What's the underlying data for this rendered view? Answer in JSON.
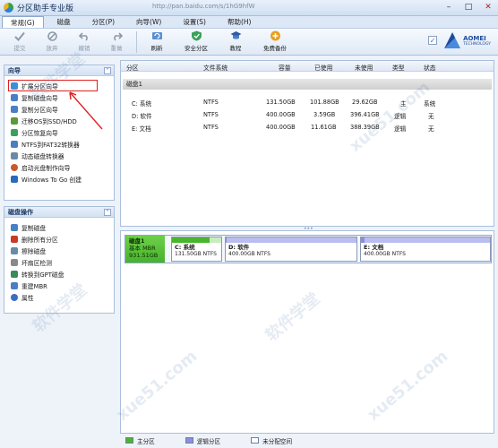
{
  "window": {
    "title": "分区助手专业版",
    "url_overlay": "http://pan.baidu.com/s/1hG9hfW"
  },
  "menu": [
    {
      "label": "常规(G)"
    },
    {
      "label": "磁盘"
    },
    {
      "label": "分区(P)"
    },
    {
      "label": "向导(W)"
    },
    {
      "label": "设置(S)"
    },
    {
      "label": "帮助(H)"
    }
  ],
  "toolbar": {
    "items": [
      {
        "label": "提交",
        "icon": "check-icon",
        "enabled": false
      },
      {
        "label": "放弃",
        "icon": "discard-icon",
        "enabled": false
      },
      {
        "label": "撤销",
        "icon": "undo-icon",
        "enabled": false
      },
      {
        "label": "重做",
        "icon": "redo-icon",
        "enabled": false
      },
      {
        "label": "刷新",
        "icon": "refresh-icon",
        "enabled": true
      },
      {
        "label": "安全分区",
        "icon": "safe-partition-icon",
        "enabled": true
      },
      {
        "label": "教程",
        "icon": "tutorial-icon",
        "enabled": true
      },
      {
        "label": "免费备份",
        "icon": "backup-icon",
        "enabled": true
      }
    ],
    "brand": {
      "name": "AOMEI",
      "sub": "TECHNOLOGY"
    }
  },
  "wizard_panel": {
    "title": "向导",
    "items": [
      {
        "label": "扩展分区向导",
        "color": "#3a8fd8"
      },
      {
        "label": "复制磁盘向导",
        "color": "#4a7fc4"
      },
      {
        "label": "复制分区向导",
        "color": "#4a7fc4"
      },
      {
        "label": "迁移OS到SSD/HDD",
        "color": "#5a9a3a"
      },
      {
        "label": "分区恢复向导",
        "color": "#3aa15a"
      },
      {
        "label": "NTFS到FAT32转换器",
        "color": "#4a7fc4"
      },
      {
        "label": "动态磁盘转换器",
        "color": "#6a8aa8"
      },
      {
        "label": "启动光盘制作向导",
        "color": "#c85a2a"
      },
      {
        "label": "Windows To Go 创建",
        "color": "#2a6ab8"
      }
    ]
  },
  "disk_ops_panel": {
    "title": "磁盘操作",
    "items": [
      {
        "label": "复制磁盘",
        "color": "#4a7fc4"
      },
      {
        "label": "删除所有分区",
        "color": "#c83a2a"
      },
      {
        "label": "擦除磁盘",
        "color": "#6a8aa8"
      },
      {
        "label": "坏扇区检测",
        "color": "#8a8a8a"
      },
      {
        "label": "转换到GPT磁盘",
        "color": "#3a8a5a"
      },
      {
        "label": "重建MBR",
        "color": "#4a7fc4"
      },
      {
        "label": "属性",
        "color": "#3a6fbf"
      }
    ]
  },
  "partition_table": {
    "columns": [
      "分区",
      "文件系统",
      "容量",
      "已使用",
      "未使用",
      "类型",
      "状态"
    ],
    "disk_label": "磁盘1",
    "rows": [
      {
        "partition": "C: 系统",
        "fs": "NTFS",
        "capacity": "131.50GB",
        "used": "101.88GB",
        "free": "29.62GB",
        "type": "主",
        "status": "系统"
      },
      {
        "partition": "D: 软件",
        "fs": "NTFS",
        "capacity": "400.00GB",
        "used": "3.59GB",
        "free": "396.41GB",
        "type": "逻辑",
        "status": "无"
      },
      {
        "partition": "E: 文档",
        "fs": "NTFS",
        "capacity": "400.00GB",
        "used": "11.61GB",
        "free": "388.39GB",
        "type": "逻辑",
        "status": "无"
      }
    ]
  },
  "disk_map": {
    "disk": {
      "name": "磁盘1",
      "type": "基本 MBR",
      "size": "931.51GB"
    },
    "partitions": [
      {
        "name": "C: 系统",
        "info": "131.50GB NTFS",
        "used_fraction": 0.77,
        "color": "#49b52e"
      },
      {
        "name": "D: 软件",
        "info": "400.00GB NTFS",
        "used_fraction": 0.01,
        "color": "#8a8ee0"
      },
      {
        "name": "E: 文档",
        "info": "400.00GB NTFS",
        "used_fraction": 0.03,
        "color": "#8a8ee0"
      }
    ]
  },
  "legend": [
    {
      "label": "主分区",
      "color": "#49b52e"
    },
    {
      "label": "逻辑分区",
      "color": "#8a8ee0"
    },
    {
      "label": "未分配空间",
      "color": "#ffffff"
    }
  ],
  "watermark": {
    "text1": "软件学堂",
    "text2": "xue51.com"
  }
}
